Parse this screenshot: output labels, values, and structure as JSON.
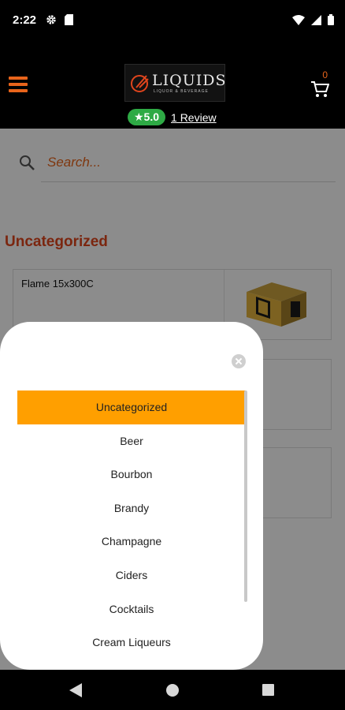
{
  "status_bar": {
    "time": "2:22",
    "icons": [
      "settings-icon",
      "sim-card-icon",
      "wifi-icon",
      "signal-icon",
      "battery-icon"
    ]
  },
  "header": {
    "menu_icon": "hamburger-menu-icon",
    "logo": {
      "text": "LIQUIDS",
      "subtext": "LIQUOR & BEVERAGE"
    },
    "cart": {
      "icon": "cart-icon",
      "count": "0"
    },
    "rating": {
      "value": "★5.0",
      "reviews_label": "1 Review"
    }
  },
  "search": {
    "placeholder": "Search..."
  },
  "section": {
    "title": "Uncategorized"
  },
  "products": [
    {
      "name": "Flame 15x300C"
    }
  ],
  "category_modal": {
    "selected_index": 0,
    "categories": [
      "Uncategorized",
      "Beer",
      "Bourbon",
      "Brandy",
      "Champagne",
      "Ciders",
      "Cocktails",
      "Cream Liqueurs"
    ]
  },
  "colors": {
    "accent": "#e8641b",
    "selected": "#ff9f00",
    "rating_green": "#2eaa45",
    "section_title": "#e0451d"
  }
}
